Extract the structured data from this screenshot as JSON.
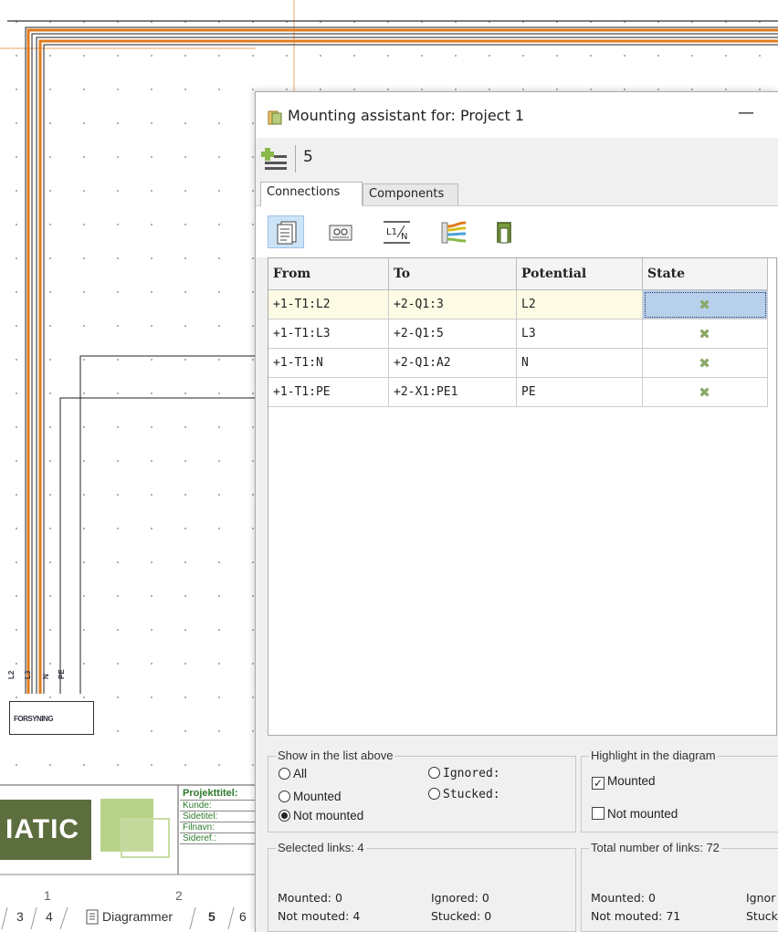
{
  "schematic": {
    "forsyning_label": "FORSYNING",
    "wire_labels": [
      "L2",
      "L3",
      "N",
      "PE"
    ],
    "logo_text": "IATIC",
    "title_block_fields": [
      "Projekttitel:",
      "Kunde:",
      "Sidetitel:",
      "Filnavn:",
      "Sideref.:"
    ],
    "page_numbers": [
      "1",
      "2"
    ],
    "sheet_tabs": [
      "3",
      "4",
      "Diagrammer",
      "5",
      "6"
    ]
  },
  "dialog": {
    "title": "Mounting assistant for: Project 1",
    "minimize_label": "—",
    "toolbar_count": "5",
    "tabs": [
      "Connections",
      "Components"
    ],
    "icon_buttons": [
      "document-list-icon",
      "terminal-icon",
      "potential-icon",
      "cable-icon",
      "bridge-icon"
    ],
    "table": {
      "columns": [
        "From",
        "To",
        "Potential",
        "State"
      ],
      "rows": [
        {
          "from": "+1-T1:L2",
          "to": "+2-Q1:3",
          "potential": "L2",
          "state": "not-mounted"
        },
        {
          "from": "+1-T1:L3",
          "to": "+2-Q1:5",
          "potential": "L3",
          "state": "not-mounted"
        },
        {
          "from": "+1-T1:N",
          "to": "+2-Q1:A2",
          "potential": "N",
          "state": "not-mounted"
        },
        {
          "from": "+1-T1:PE",
          "to": "+2-X1:PE1",
          "potential": "PE",
          "state": "not-mounted"
        }
      ],
      "selected_row": 0
    },
    "show_in_list": {
      "title": "Show in the list above",
      "options": [
        "All",
        "Mounted",
        "Not mounted",
        "Ignored:",
        "Stucked:"
      ],
      "selected": "Not mounted"
    },
    "highlight": {
      "title": "Highlight in the diagram",
      "mounted_label": "Mounted",
      "mounted_checked": true,
      "not_mounted_label": "Not mounted",
      "not_mounted_checked": false
    },
    "selected_links": {
      "title": "Selected links: 4",
      "mounted": "Mounted: 0",
      "not_mounted": "Not mouted: 4",
      "ignored": "Ignored: 0",
      "stucked": "Stucked: 0"
    },
    "total_links": {
      "title": "Total number of links: 72",
      "mounted": "Mounted: 0",
      "not_mounted": "Not mouted: 71",
      "ignored": "Ignor",
      "stucked": "Stuck"
    }
  },
  "colors": {
    "wire_orange": "#e07a1c",
    "logo_green": "#5d6e3e",
    "logo_light": "#b9d28a",
    "selection_blue": "#b7d0ec",
    "state_icon": "#8aa866"
  }
}
